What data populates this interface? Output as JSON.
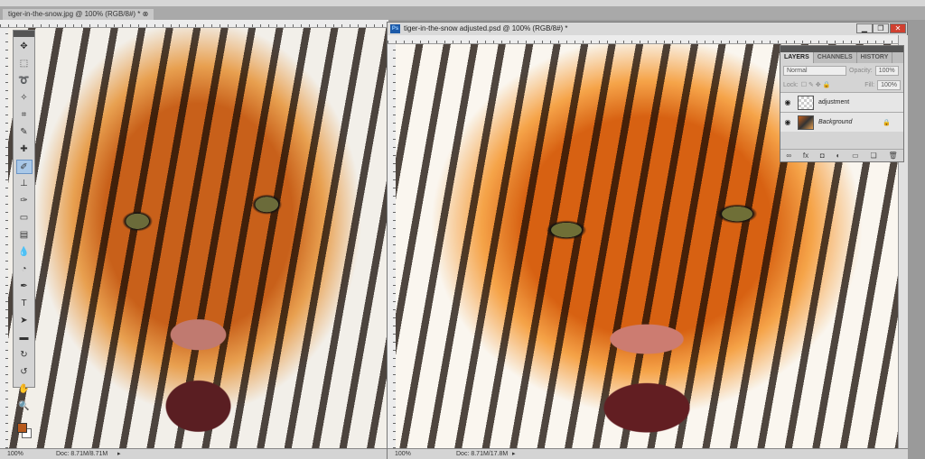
{
  "left_document": {
    "tab_title": "tiger-in-the-snow.jpg @ 100% (RGB/8#) *",
    "close_label": "⊗",
    "zoom": "100%",
    "doc_info": "Doc: 8.71M/8.71M"
  },
  "right_document": {
    "title": "tiger-in-the-snow adjusted.psd @ 100% (RGB/8#) *",
    "app_icon": "Ps",
    "zoom": "100%",
    "doc_info": "Doc: 8.71M/17.8M",
    "min": "▁",
    "restore": "❐",
    "close": "✕"
  },
  "tools": [
    "move",
    "marquee",
    "lasso",
    "magic-wand",
    "crop",
    "eyedropper",
    "healing-brush",
    "brush",
    "clone-stamp",
    "history-brush",
    "eraser",
    "gradient",
    "blur",
    "dodge",
    "pen",
    "type",
    "path-selection",
    "shape",
    "3d-rotate",
    "3d-orbit",
    "hand",
    "zoom"
  ],
  "tool_glyphs": [
    "✥",
    "⬚",
    "➰",
    "✧",
    "⌗",
    "✎",
    "✚",
    "✐",
    "⊥",
    "✑",
    "▭",
    "▤",
    "💧",
    "◔",
    "✒",
    "T",
    "➤",
    "▬",
    "↻",
    "↺",
    "✋",
    "🔍"
  ],
  "colors": {
    "foreground": "#b85a1c",
    "background": "#ffffff"
  },
  "layers_panel": {
    "tabs": [
      "LAYERS",
      "CHANNELS",
      "HISTORY"
    ],
    "blend_mode": "Normal",
    "opacity_label": "Opacity:",
    "opacity": "100%",
    "lock_label": "Lock:",
    "fill_label": "Fill:",
    "fill": "100%",
    "layers": [
      {
        "name": "adjustment"
      },
      {
        "name": "Background",
        "locked": true
      }
    ],
    "footer_icons": [
      "∞",
      "fx",
      "◘",
      "◐",
      "▭",
      "❏",
      "🗑"
    ]
  }
}
